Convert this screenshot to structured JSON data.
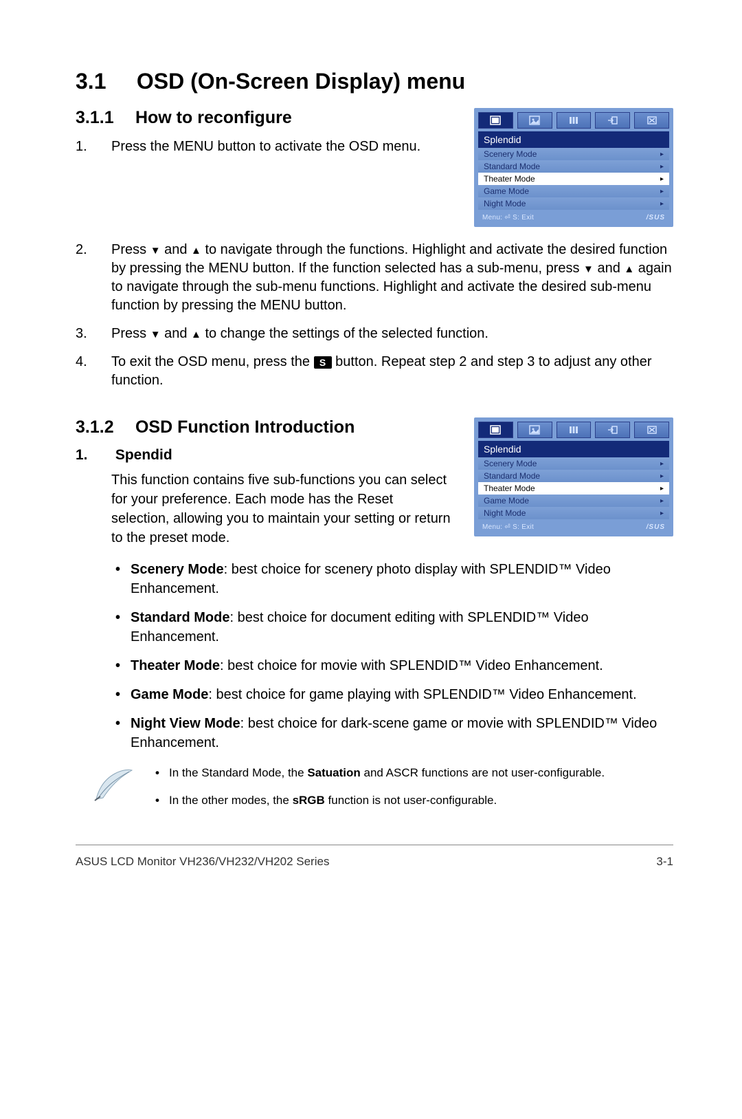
{
  "section": {
    "num": "3.1",
    "title": "OSD (On-Screen Display) menu"
  },
  "sub1": {
    "num": "3.1.1",
    "title": "How to reconfigure",
    "steps": [
      "Press the MENU button to activate the OSD menu.",
      "Press ▼ and ▲ to navigate through the functions. Highlight and activate the desired function by pressing the MENU button. If the function selected has a sub-menu, press ▼ and ▲ again to navigate through the sub-menu functions. Highlight and activate the desired sub-menu function by pressing the MENU button.",
      "Press ▼ and ▲ to change the settings of the selected function.",
      "To exit the OSD menu, press the S button. Repeat step 2 and step 3 to adjust any other function."
    ]
  },
  "sub2": {
    "num": "3.1.2",
    "title": "OSD Function Introduction",
    "item_num": "1.",
    "item_title": "Spendid",
    "item_para": "This function contains five sub-functions you can select for your preference. Each mode has the Reset selection, allowing you to maintain your setting or return to the preset mode.",
    "modes": [
      {
        "name": "Scenery Mode",
        "desc": ": best choice for scenery photo display with SPLENDID™ Video Enhancement."
      },
      {
        "name": "Standard Mode",
        "desc": ": best choice for document editing with SPLENDID™ Video Enhancement."
      },
      {
        "name": "Theater Mode",
        "desc": ": best choice for movie with SPLENDID™ Video Enhancement."
      },
      {
        "name": "Game Mode",
        "desc": ": best choice for game playing with SPLENDID™ Video Enhancement."
      },
      {
        "name": "Night View Mode",
        "desc": ": best choice for dark-scene game or movie with SPLENDID™ Video Enhancement."
      }
    ],
    "notes": [
      {
        "pre": "In the Standard Mode, the ",
        "bold": "Satuation",
        "post": " and ASCR functions are not user-configurable."
      },
      {
        "pre": "In the other modes, the ",
        "bold": "sRGB",
        "post": " function is not user-configurable."
      }
    ]
  },
  "osd": {
    "title": "Splendid",
    "rows": [
      "Scenery Mode",
      "Standard Mode",
      "Theater Mode",
      "Game Mode",
      "Night Mode"
    ],
    "selected_index": 2,
    "foot_left": "Menu: ⏎     S: Exit",
    "brand": "/SUS"
  },
  "footer": {
    "left": "ASUS LCD Monitor  VH236/VH232/VH202 Series",
    "right": "3-1"
  }
}
